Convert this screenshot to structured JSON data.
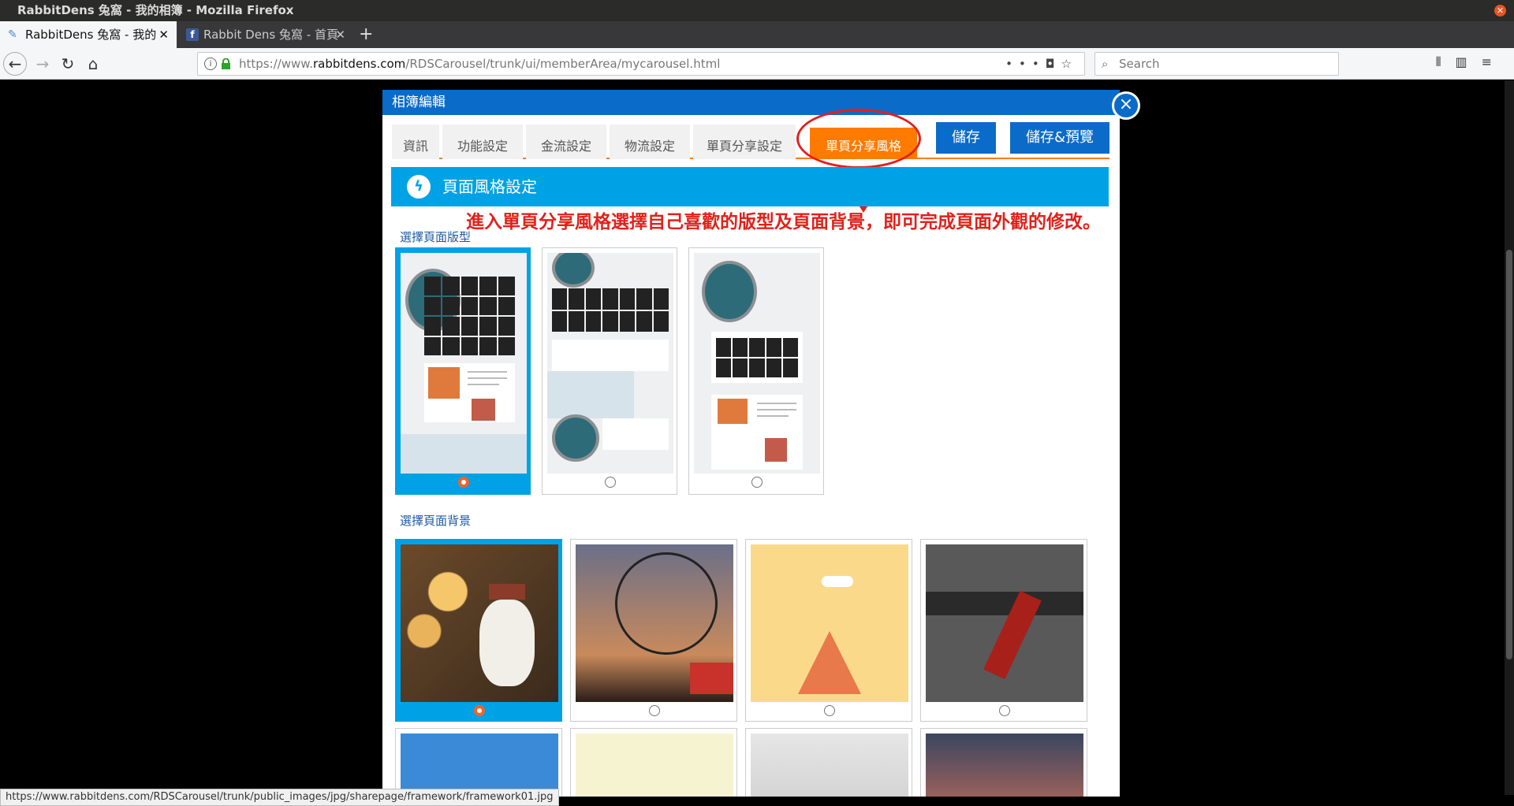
{
  "window": {
    "title": "RabbitDens 兔窩 - 我的相簿 - Mozilla Firefox"
  },
  "tabs": [
    {
      "label": "RabbitDens 兔窩 - 我的相…"
    },
    {
      "label": "Rabbit Dens 兔窩 - 首頁"
    }
  ],
  "url": {
    "prefix": "https://www.",
    "host": "rabbitdens.com",
    "path": "/RDSCarousel/trunk/ui/memberArea/mycarousel.html"
  },
  "search": {
    "placeholder": "Search"
  },
  "modal": {
    "title": "相簿編輯",
    "close": "×",
    "tabs": [
      "資訊",
      "功能設定",
      "金流設定",
      "物流設定",
      "單頁分享設定",
      "單頁分享風格"
    ],
    "save": "儲存",
    "save_preview": "儲存&預覽",
    "section_title": "頁面風格設定",
    "annotation": "進入單頁分享風格選擇自己喜歡的版型及頁面背景，即可完成頁面外觀的修改。",
    "layout_label": "選擇頁面版型",
    "background_label": "選擇頁面背景",
    "selected_layout": 1,
    "selected_background": 1
  },
  "status_url": "https://www.rabbitdens.com/RDSCarousel/trunk/public_images/jpg/sharepage/framework/framework01.jpg",
  "colors": {
    "primary": "#0b6bc9",
    "accent": "#ff7b00",
    "section": "#00a2e6",
    "annotation": "#e1211b"
  }
}
